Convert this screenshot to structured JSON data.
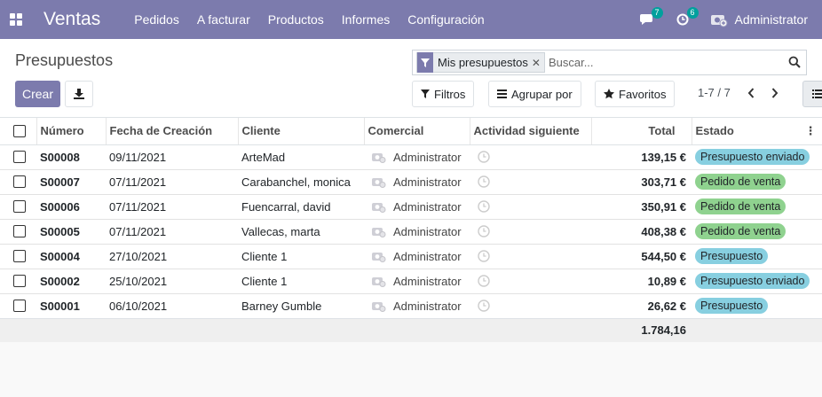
{
  "navbar": {
    "brand": "Ventas",
    "menu": [
      "Pedidos",
      "A facturar",
      "Productos",
      "Informes",
      "Configuración"
    ],
    "messages_count": "7",
    "activities_count": "6",
    "user": "Administrator"
  },
  "control_panel": {
    "title": "Presupuestos",
    "create_label": "Crear",
    "search": {
      "facet_label": "Mis presupuestos",
      "placeholder": "Buscar..."
    },
    "filters_label": "Filtros",
    "groupby_label": "Agrupar por",
    "favorites_label": "Favoritos",
    "pager": "1-7 / 7"
  },
  "table": {
    "headers": {
      "number": "Número",
      "date": "Fecha de Creación",
      "customer": "Cliente",
      "salesperson": "Comercial",
      "activity": "Actividad siguiente",
      "total": "Total",
      "state": "Estado"
    },
    "rows": [
      {
        "number": "S00008",
        "date": "09/11/2021",
        "customer": "ArteMad",
        "salesperson": "Administrator",
        "total": "139,15 €",
        "state": "Presupuesto enviado",
        "state_type": "info"
      },
      {
        "number": "S00007",
        "date": "07/11/2021",
        "customer": "Carabanchel, monica",
        "salesperson": "Administrator",
        "total": "303,71 €",
        "state": "Pedido de venta",
        "state_type": "success"
      },
      {
        "number": "S00006",
        "date": "07/11/2021",
        "customer": "Fuencarral, david",
        "salesperson": "Administrator",
        "total": "350,91 €",
        "state": "Pedido de venta",
        "state_type": "success"
      },
      {
        "number": "S00005",
        "date": "07/11/2021",
        "customer": "Vallecas, marta",
        "salesperson": "Administrator",
        "total": "408,38 €",
        "state": "Pedido de venta",
        "state_type": "success"
      },
      {
        "number": "S00004",
        "date": "27/10/2021",
        "customer": "Cliente 1",
        "salesperson": "Administrator",
        "total": "544,50 €",
        "state": "Presupuesto",
        "state_type": "info"
      },
      {
        "number": "S00002",
        "date": "25/10/2021",
        "customer": "Cliente 1",
        "salesperson": "Administrator",
        "total": "10,89 €",
        "state": "Presupuesto enviado",
        "state_type": "info"
      },
      {
        "number": "S00001",
        "date": "06/10/2021",
        "customer": "Barney Gumble",
        "salesperson": "Administrator",
        "total": "26,62 €",
        "state": "Presupuesto",
        "state_type": "info"
      }
    ],
    "footer_total": "1.784,16"
  },
  "colors": {
    "brand": "#7c7bad",
    "badge": "#00a09d",
    "state_info": "#87cfe0",
    "state_success": "#8fd28f"
  },
  "icons": [
    "apps-icon",
    "chat-icon",
    "clock-icon",
    "avatar-icon",
    "filter-icon",
    "close-icon",
    "search-icon",
    "download-icon",
    "list-icon",
    "star-icon",
    "chevron-left-icon",
    "chevron-right-icon",
    "optional-columns-icon"
  ]
}
